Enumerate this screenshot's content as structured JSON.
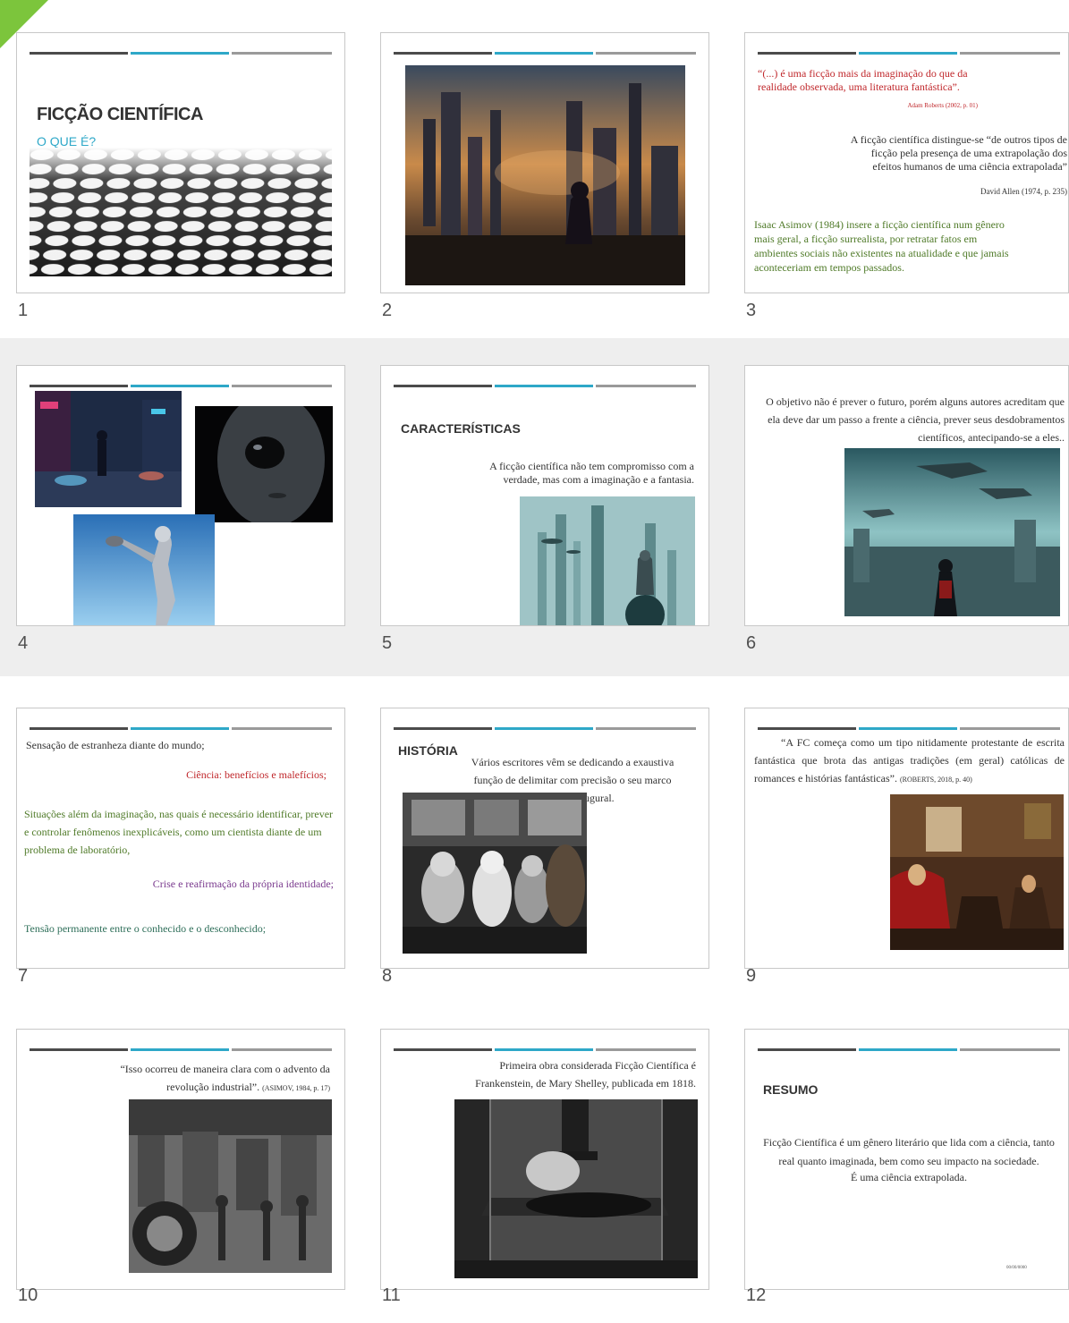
{
  "slides": [
    {
      "number": "1",
      "title": "FICÇÃO CIENTÍFICA",
      "subtitle": "O QUE É?"
    },
    {
      "number": "2"
    },
    {
      "number": "3",
      "quote": "“(...) é uma ficção mais da imaginação do que da realidade observada, uma literatura fantástica”.",
      "quote_cite": "Adam Roberts (2002, p. 01)",
      "allen_text": "A ficção científica distingue-se “de outros tipos de ficção pela presença de uma extrapolação dos efeitos humanos de uma ciência extrapolada”",
      "allen_cite": "David Allen (1974, p. 235)",
      "asimov_text": "Isaac Asimov (1984) insere a ficção científica num gênero mais geral, a ficção surrealista, por retratar fatos em ambientes sociais não existentes na atualidade e que jamais aconteceriam em tempos passados."
    },
    {
      "number": "4"
    },
    {
      "number": "5",
      "heading": "CARACTERÍSTICAS",
      "text": "A ficção científica não tem compromisso com a verdade, mas com a imaginação e a fantasia."
    },
    {
      "number": "6",
      "text": "O objetivo não é prever o futuro, porém alguns autores acreditam que ela deve dar um passo a frente a ciência, prever seus desdobramentos científicos, antecipando-se a eles.."
    },
    {
      "number": "7",
      "line1": "Sensação de estranheza diante do mundo;",
      "line2": "Ciência: benefícios e malefícios;",
      "line3": "Situações além da imaginação, nas quais é necessário identificar, prever e controlar fenômenos inexplicáveis, como um cientista diante de um problema de laboratório,",
      "line4": "Crise e reafirmação da própria identidade;",
      "line5": "Tensão permanente entre o conhecido e o desconhecido;"
    },
    {
      "number": "8",
      "heading": "HISTÓRIA",
      "text": "Vários escritores vêm se dedicando a exaustiva função de delimitar com precisão o seu marco histórico inaugural."
    },
    {
      "number": "9",
      "quote": "“A FC começa como um tipo nitidamente protestante de escrita fantástica que brota das antigas tradições (em geral) católicas de romances e histórias fantásticas”.",
      "cite": "(ROBERTS, 2018, p. 40)"
    },
    {
      "number": "10",
      "quote": "“Isso ocorreu de maneira clara com o advento da revolução industrial”.",
      "cite": "(ASIMOV, 1984, p. 17)"
    },
    {
      "number": "11",
      "text": "Primeira obra considerada Ficção Científica é Frankenstein, de Mary Shelley, publicada em 1818."
    },
    {
      "number": "12",
      "heading": "RESUMO",
      "text1": "Ficção Científica é um gênero literário que lida com a ciência, tanto real quanto imaginada, bem como seu impacto na sociedade.",
      "text2": "É uma ciência extrapolada.",
      "footer": "00/00/0000"
    }
  ],
  "colors": {
    "accent_blue": "#2ea8c8",
    "quote_red": "#c0282c",
    "green": "#4f7a28",
    "purple": "#7a3a8e",
    "selection_green": "#7cc53c"
  }
}
